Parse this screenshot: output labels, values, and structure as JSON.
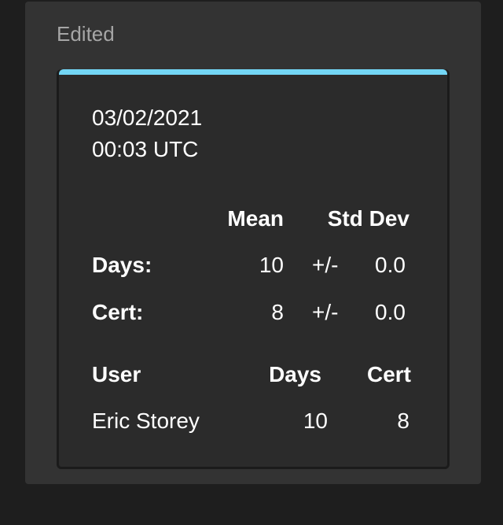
{
  "panel": {
    "title": "Edited"
  },
  "card": {
    "accent_color": "#73d6f5",
    "date": "03/02/2021",
    "time": "00:03 UTC",
    "stats": {
      "headers": {
        "mean": "Mean",
        "std_dev": "Std Dev"
      },
      "rows": [
        {
          "label": "Days:",
          "mean": "10",
          "pm": "+/-",
          "std": "0.0"
        },
        {
          "label": "Cert:",
          "mean": "8",
          "pm": "+/-",
          "std": "0.0"
        }
      ]
    },
    "users": {
      "headers": {
        "user": "User",
        "days": "Days",
        "cert": "Cert"
      },
      "rows": [
        {
          "name": "Eric Storey",
          "days": "10",
          "cert": "8"
        }
      ]
    }
  }
}
